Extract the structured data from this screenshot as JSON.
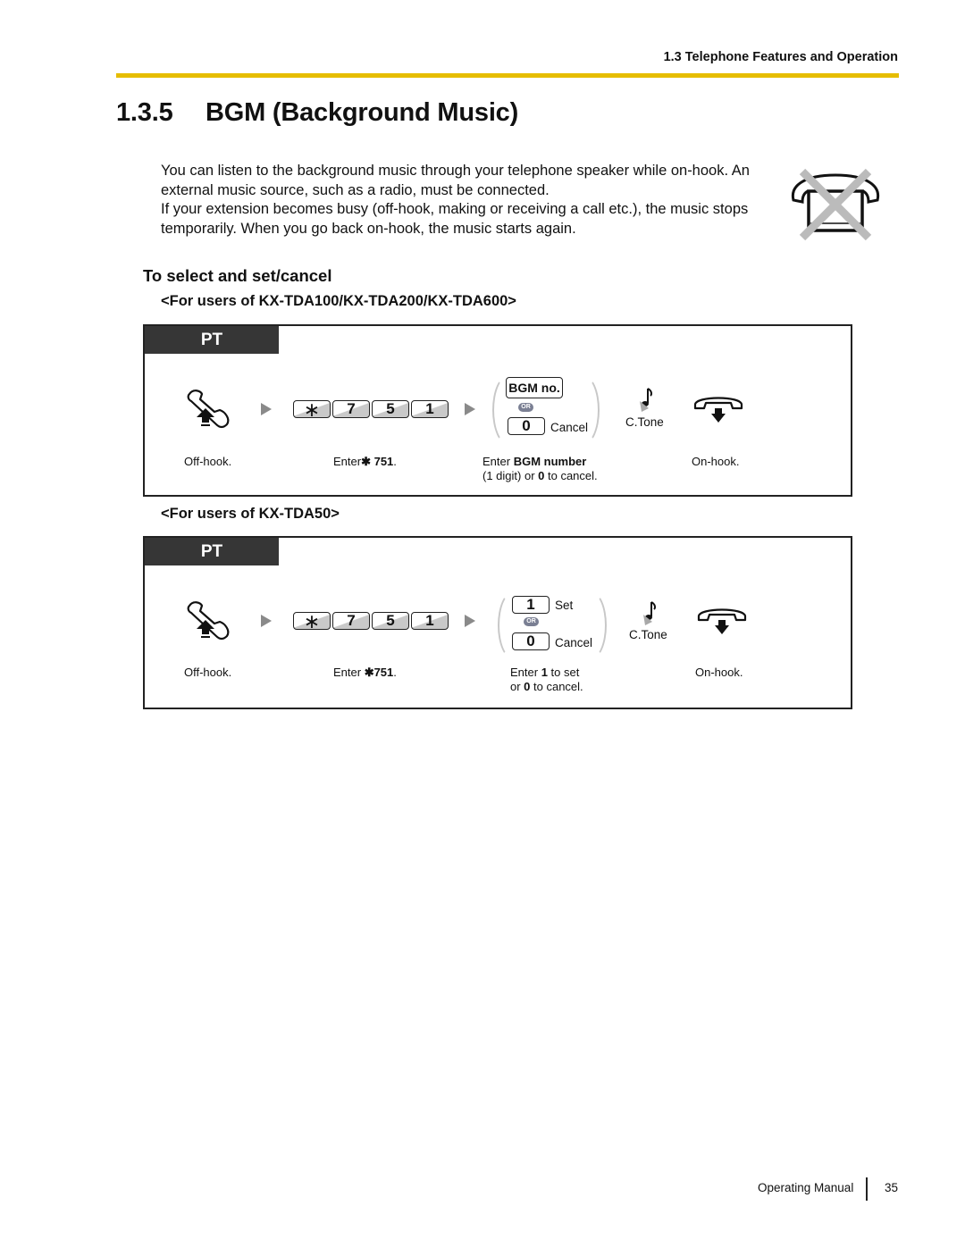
{
  "header": {
    "running_title": "1.3 Telephone Features and Operation"
  },
  "section": {
    "number": "1.3.5",
    "title": "BGM (Background Music)"
  },
  "intro": {
    "paragraph_1": "You can listen to the background music through your telephone speaker while on-hook. An external music source, such as a radio, must be connected.",
    "paragraph_2": "If your extension becomes busy (off-hook, making or receiving a call etc.), the music stops temporarily. When you go back on-hook, the music starts again."
  },
  "icons": {
    "side_icon": "phone-crossed-out-icon",
    "off_hook": "off-hook-handset-icon",
    "on_hook": "on-hook-handset-icon",
    "tone": "confirmation-tone-note-icon",
    "step_arrow": "triangle-right-icon"
  },
  "procedure": {
    "heading": "To select and set/cancel",
    "blocks": [
      {
        "for_users": "<For users of KX-TDA100/KX-TDA200/KX-TDA600>",
        "tab": "PT",
        "keys": [
          "∗",
          "7",
          "5",
          "1"
        ],
        "option_a": {
          "key": "BGM no.",
          "label": ""
        },
        "or_label": "OR",
        "option_b": {
          "key": "0",
          "label": "Cancel"
        },
        "tone_label": "C.Tone",
        "captions": {
          "off_hook": "Off-hook.",
          "enter_prefix": "Enter",
          "enter_code": "✱ 751",
          "enter_suffix": ".",
          "select_line1_prefix": "Enter ",
          "select_line1_bold": "BGM number",
          "select_line2_prefix": "(1 digit) or ",
          "select_line2_bold": "0",
          "select_line2_suffix": " to cancel.",
          "on_hook": "On-hook."
        }
      },
      {
        "for_users": "<For users of KX-TDA50>",
        "tab": "PT",
        "keys": [
          "∗",
          "7",
          "5",
          "1"
        ],
        "option_a": {
          "key": "1",
          "label": "Set"
        },
        "or_label": "OR",
        "option_b": {
          "key": "0",
          "label": "Cancel"
        },
        "tone_label": "C.Tone",
        "captions": {
          "off_hook": "Off-hook.",
          "enter_prefix": "Enter ",
          "enter_code": "✱751",
          "enter_suffix": ".",
          "select_line1_prefix": "Enter ",
          "select_line1_bold": "1",
          "select_line1_suffix": " to set",
          "select_line2_prefix": "or ",
          "select_line2_bold": "0",
          "select_line2_suffix": " to cancel.",
          "on_hook": "On-hook."
        }
      }
    ]
  },
  "footer": {
    "manual_name": "Operating Manual",
    "page_number": "35"
  },
  "colors": {
    "rule": "#e6bd00",
    "tab_bg": "#363636",
    "or_badge": "#7a7f93"
  }
}
